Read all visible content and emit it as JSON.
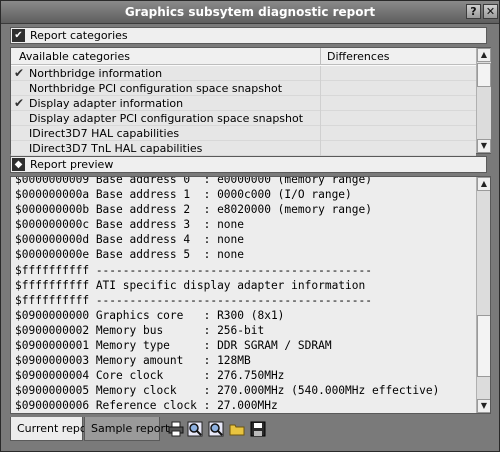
{
  "window": {
    "title": "Graphics subsytem diagnostic report",
    "help_label": "?",
    "close_label": "✕"
  },
  "categories_section": {
    "label": "Report categories",
    "column_available": "Available categories",
    "column_differences": "Differences",
    "items": [
      {
        "label": "Northbridge information",
        "checked": true
      },
      {
        "label": "Northbridge PCI configuration space snapshot",
        "checked": false
      },
      {
        "label": "Display adapter information",
        "checked": true
      },
      {
        "label": "Display adapter PCI configuration space snapshot",
        "checked": false
      },
      {
        "label": "IDirect3D7 HAL capabilities",
        "checked": false
      },
      {
        "label": "IDirect3D7 TnL HAL capabilities",
        "checked": false
      }
    ]
  },
  "preview_section": {
    "label": "Report preview",
    "lines": [
      "$0000000009 Base address 0  : e0000000 (memory range)",
      "$000000000a Base address 1  : 0000c000 (I/O range)",
      "$000000000b Base address 2  : e8020000 (memory range)",
      "$000000000c Base address 3  : none",
      "$000000000d Base address 4  : none",
      "$000000000e Base address 5  : none",
      "$ffffffffff -----------------------------------------",
      "$ffffffffff ATI specific display adapter information",
      "$ffffffffff -----------------------------------------",
      "$0900000000 Graphics core   : R300 (8x1)",
      "$0900000002 Memory bus      : 256-bit",
      "$0900000001 Memory type     : DDR SGRAM / SDRAM",
      "$0900000003 Memory amount   : 128MB",
      "$0900000004 Core clock      : 276.750MHz",
      "$0900000005 Memory clock    : 270.000MHz (540.000MHz effective)",
      "$0900000006 Reference clock : 27.000MHz"
    ]
  },
  "tabs": {
    "current": "Current report",
    "sample": "Sample report"
  },
  "icons": {
    "section_toggle": "checkmark-icon",
    "preview_toggle": "diamond-icon",
    "toolbar": [
      "print-icon",
      "zoom-icon",
      "zoom-icon",
      "folder-icon",
      "save-icon"
    ]
  }
}
